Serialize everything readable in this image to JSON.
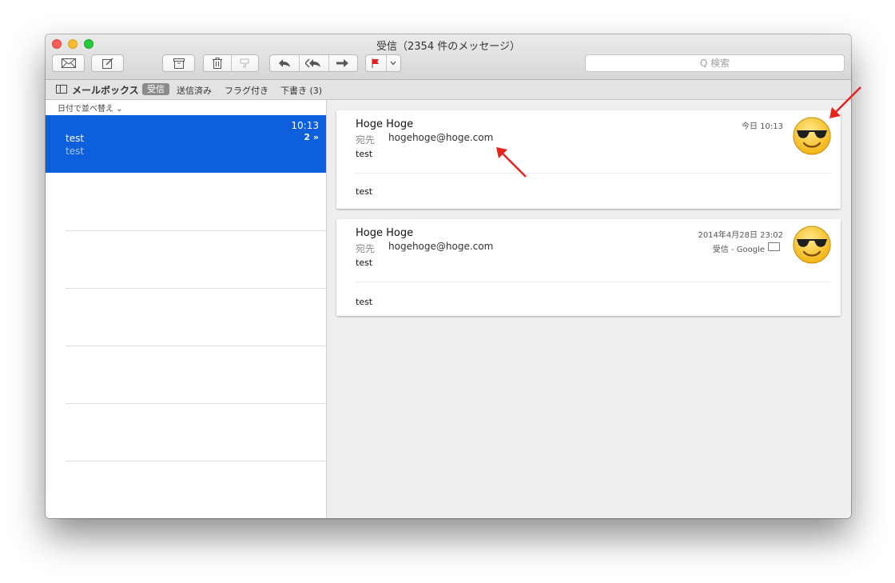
{
  "window": {
    "title": "受信（2354 件のメッセージ）"
  },
  "toolbar": {
    "search_placeholder": "Q 検索",
    "icons": [
      "compose-envelope-icon",
      "new-message-icon",
      "archive-icon",
      "trash-icon",
      "junk-icon",
      "reply-icon",
      "reply-all-icon",
      "forward-icon",
      "flag-icon",
      "chevron-down-icon"
    ]
  },
  "favorites": {
    "mailboxes_label": "メールボックス",
    "inbox_label": "受信",
    "sent_label": "送信済み",
    "flagged_label": "フラグ付き",
    "drafts_label": "下書き (3)"
  },
  "sidebar": {
    "sort_label": "日付で並べ替え ⌄",
    "selected_message": {
      "subject": "test",
      "preview": "test",
      "time": "10:13",
      "thread_count": "2 »"
    }
  },
  "messages": [
    {
      "from": "Hoge Hoge",
      "to_label": "宛先",
      "to": "hogehoge@hoge.com",
      "subject": "test",
      "date": "今日 10:13",
      "body": "test"
    },
    {
      "from": "Hoge Hoge",
      "to_label": "宛先",
      "to": "hogehoge@hoge.com",
      "subject": "test",
      "date": "2014年4月28日 23:02",
      "mailbox": "受信 - Google",
      "body": "test"
    }
  ],
  "colors": {
    "selection": "#0e5fdc",
    "annotation_arrow": "#e8221c",
    "flag": "#e02020"
  }
}
